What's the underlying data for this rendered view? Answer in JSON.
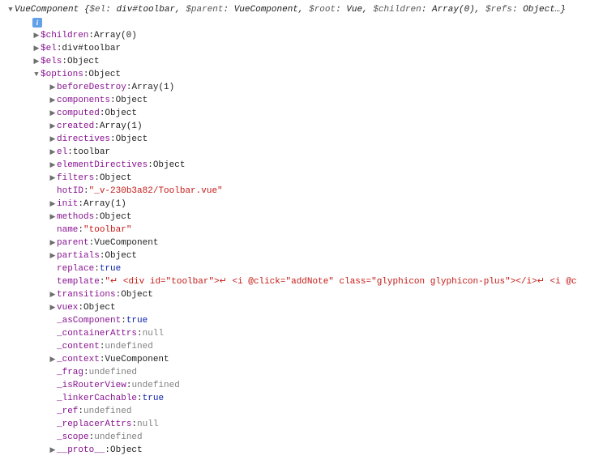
{
  "header": {
    "type": "VueComponent",
    "props": [
      {
        "k": "$el",
        "v": "div#toolbar"
      },
      {
        "k": "$parent",
        "v": "VueComponent"
      },
      {
        "k": "$root",
        "v": "Vue"
      },
      {
        "k": "$children",
        "v": "Array(0)"
      },
      {
        "k": "$refs",
        "v": "Object…"
      }
    ]
  },
  "rows": [
    {
      "indent": 1,
      "kind": "info"
    },
    {
      "indent": 1,
      "arrow": "right",
      "key": "$children",
      "val": "Array(0)",
      "vtype": "type"
    },
    {
      "indent": 1,
      "arrow": "right",
      "key": "$el",
      "val": "div#toolbar",
      "vtype": "type"
    },
    {
      "indent": 1,
      "arrow": "right",
      "key": "$els",
      "val": "Object",
      "vtype": "type"
    },
    {
      "indent": 1,
      "arrow": "down",
      "key": "$options",
      "val": "Object",
      "vtype": "type"
    },
    {
      "indent": 2,
      "arrow": "right",
      "key": "beforeDestroy",
      "val": "Array(1)",
      "vtype": "type"
    },
    {
      "indent": 2,
      "arrow": "right",
      "key": "components",
      "val": "Object",
      "vtype": "type"
    },
    {
      "indent": 2,
      "arrow": "right",
      "key": "computed",
      "val": "Object",
      "vtype": "type"
    },
    {
      "indent": 2,
      "arrow": "right",
      "key": "created",
      "val": "Array(1)",
      "vtype": "type"
    },
    {
      "indent": 2,
      "arrow": "right",
      "key": "directives",
      "val": "Object",
      "vtype": "type"
    },
    {
      "indent": 2,
      "arrow": "right",
      "key": "el",
      "val": "toolbar",
      "vtype": "type"
    },
    {
      "indent": 2,
      "arrow": "right",
      "key": "elementDirectives",
      "val": "Object",
      "vtype": "type"
    },
    {
      "indent": 2,
      "arrow": "right",
      "key": "filters",
      "val": "Object",
      "vtype": "type"
    },
    {
      "indent": 2,
      "arrow": "none",
      "key": "hotID",
      "val": "\"_v-230b3a82/Toolbar.vue\"",
      "vtype": "str"
    },
    {
      "indent": 2,
      "arrow": "right",
      "key": "init",
      "val": "Array(1)",
      "vtype": "type"
    },
    {
      "indent": 2,
      "arrow": "right",
      "key": "methods",
      "val": "Object",
      "vtype": "type"
    },
    {
      "indent": 2,
      "arrow": "none",
      "key": "name",
      "val": "\"toolbar\"",
      "vtype": "str"
    },
    {
      "indent": 2,
      "arrow": "right",
      "key": "parent",
      "val": "VueComponent",
      "vtype": "type"
    },
    {
      "indent": 2,
      "arrow": "right",
      "key": "partials",
      "val": "Object",
      "vtype": "type"
    },
    {
      "indent": 2,
      "arrow": "none",
      "key": "replace",
      "val": "true",
      "vtype": "bool"
    },
    {
      "indent": 2,
      "arrow": "none",
      "key": "template",
      "val": "\"↵   <div id=\"toolbar\">↵     <i @click=\"addNote\" class=\"glyphicon glyphicon-plus\"></i>↵     <i @c",
      "vtype": "str"
    },
    {
      "indent": 2,
      "arrow": "right",
      "key": "transitions",
      "val": "Object",
      "vtype": "type"
    },
    {
      "indent": 2,
      "arrow": "right",
      "key": "vuex",
      "val": "Object",
      "vtype": "type"
    },
    {
      "indent": 2,
      "arrow": "none",
      "key": "_asComponent",
      "val": "true",
      "vtype": "bool"
    },
    {
      "indent": 2,
      "arrow": "none",
      "key": "_containerAttrs",
      "val": "null",
      "vtype": "undef"
    },
    {
      "indent": 2,
      "arrow": "none",
      "key": "_content",
      "val": "undefined",
      "vtype": "undef"
    },
    {
      "indent": 2,
      "arrow": "right",
      "key": "_context",
      "val": "VueComponent",
      "vtype": "type"
    },
    {
      "indent": 2,
      "arrow": "none",
      "key": "_frag",
      "val": "undefined",
      "vtype": "undef"
    },
    {
      "indent": 2,
      "arrow": "none",
      "key": "_isRouterView",
      "val": "undefined",
      "vtype": "undef"
    },
    {
      "indent": 2,
      "arrow": "none",
      "key": "_linkerCachable",
      "val": "true",
      "vtype": "bool"
    },
    {
      "indent": 2,
      "arrow": "none",
      "key": "_ref",
      "val": "undefined",
      "vtype": "undef"
    },
    {
      "indent": 2,
      "arrow": "none",
      "key": "_replacerAttrs",
      "val": "null",
      "vtype": "undef"
    },
    {
      "indent": 2,
      "arrow": "none",
      "key": "_scope",
      "val": "undefined",
      "vtype": "undef"
    },
    {
      "indent": 2,
      "arrow": "right",
      "key": "__proto__",
      "val": "Object",
      "vtype": "type"
    }
  ],
  "glyphs": {
    "right": "▶",
    "down": "▼",
    "info": "i"
  },
  "indentUnit": 20,
  "baseIndent": 12
}
